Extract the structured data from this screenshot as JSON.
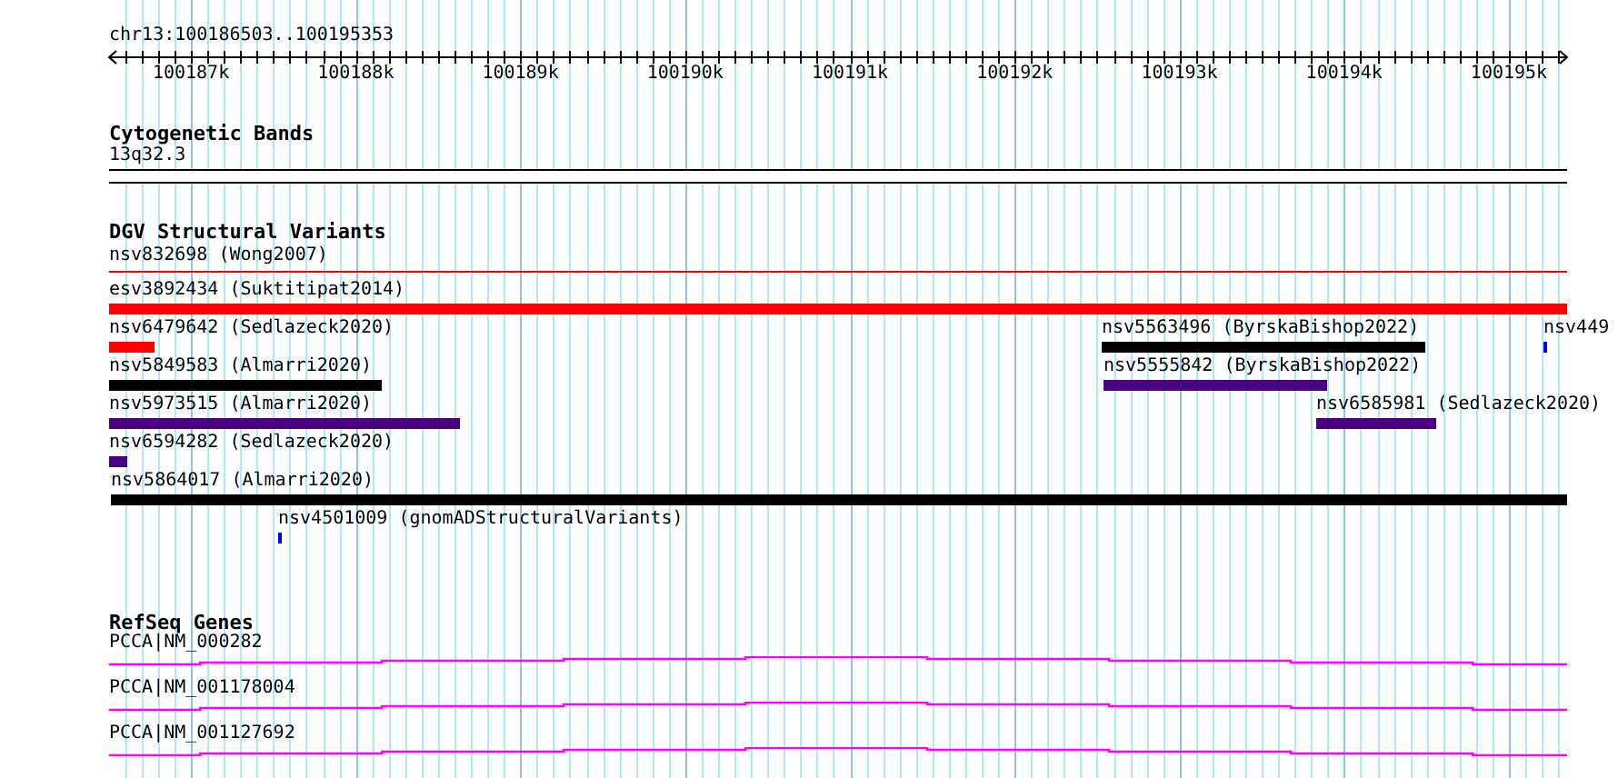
{
  "ruler": {
    "region": "chr13:100186503..100195353",
    "tick_labels": [
      "100187k",
      "100188k",
      "100189k",
      "100190k",
      "100191k",
      "100192k",
      "100193k",
      "100194k",
      "100195k"
    ]
  },
  "cytogenetic_bands": {
    "title": "Cytogenetic Bands",
    "band": "13q32.3"
  },
  "dgv_track": {
    "title": "DGV Structural Variants",
    "rows": [
      {
        "features": [
          {
            "label": "nsv832698 (Wong2007)",
            "kind": "line",
            "color": "#ff0000"
          }
        ]
      },
      {
        "features": [
          {
            "label": "esv3892434 (Suktitipat2014)",
            "kind": "bar",
            "color": "#ff0000"
          }
        ]
      },
      {
        "features": [
          {
            "label": "nsv6479642 (Sedlazeck2020)",
            "kind": "bar",
            "color": "#ff0000"
          },
          {
            "label": "nsv5563496 (ByrskaBishop2022)",
            "kind": "bar",
            "color": "#000000"
          },
          {
            "label": "nsv449",
            "kind": "bar",
            "color": "#0000ff"
          }
        ]
      },
      {
        "features": [
          {
            "label": "nsv5849583 (Almarri2020)",
            "kind": "bar",
            "color": "#000000"
          },
          {
            "label": "nsv5555842 (ByrskaBishop2022)",
            "kind": "bar",
            "color": "#4b0082"
          }
        ]
      },
      {
        "features": [
          {
            "label": "nsv5973515 (Almarri2020)",
            "kind": "bar",
            "color": "#4b0082"
          },
          {
            "label": "nsv6585981 (Sedlazeck2020)",
            "kind": "bar",
            "color": "#4b0082"
          }
        ]
      },
      {
        "features": [
          {
            "label": "nsv6594282 (Sedlazeck2020)",
            "kind": "bar",
            "color": "#4b0082"
          }
        ]
      },
      {
        "features": [
          {
            "label": "nsv5864017 (Almarri2020)",
            "kind": "bar",
            "color": "#000000"
          }
        ]
      },
      {
        "features": [
          {
            "label": "nsv4501009 (gnomADStructuralVariants)",
            "kind": "bar",
            "color": "#0000ff"
          }
        ]
      }
    ]
  },
  "refseq_track": {
    "title": "RefSeq Genes",
    "genes": [
      {
        "label": "PCCA|NM_000282"
      },
      {
        "label": "PCCA|NM_001178004"
      },
      {
        "label": "PCCA|NM_001127692"
      }
    ]
  }
}
